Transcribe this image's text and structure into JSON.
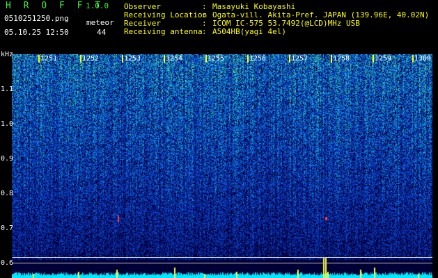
{
  "header": {
    "app_title": "H R O F F T",
    "version": "1.0.0",
    "filename": "0510251250.png",
    "timestamp": "05.10.25 12:50",
    "meteor_label": "meteor",
    "meteor_count": "44",
    "info": [
      {
        "key": "Observer",
        "value": "Masayuki Kobayashi"
      },
      {
        "key": "Receiving Location",
        "value": "Ogata-vill. Akita-Pref. JAPAN (139.96E, 40.02N)"
      },
      {
        "key": "Receiver",
        "value": "ICOM IC-575 53.7492(@LCD)MHz USB"
      },
      {
        "key": "Receiving antenna",
        "value": "A504HB(yagi 4el)"
      }
    ]
  },
  "spectrogram": {
    "y_unit": "kHz",
    "y_ticks": [
      "1.1",
      "1.0",
      "0.9",
      "0.8",
      "0.7",
      "0.6"
    ],
    "time_ticks": [
      "1251",
      "1252",
      "1253",
      "1254",
      "1255",
      "1256",
      "1257",
      "1258",
      "1259",
      "1300"
    ],
    "colors": {
      "low": "#000040",
      "mid": "#1a4fd0",
      "high": "#40e8b0",
      "peak": "#ffff40",
      "baseline": "#00e8ff"
    }
  }
}
